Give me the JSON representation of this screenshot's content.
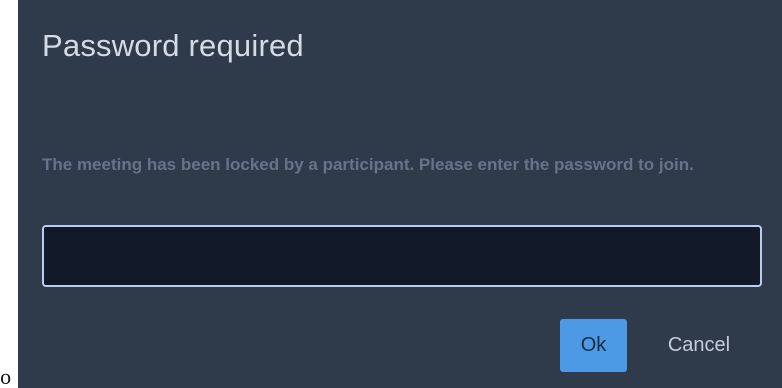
{
  "background_text": {
    "fragment": "to"
  },
  "dialog": {
    "title": "Password required",
    "message": "The meeting has been locked by a participant. Please enter the password to join.",
    "password_input": {
      "value": "",
      "placeholder": ""
    },
    "ok_label": "Ok",
    "cancel_label": "Cancel"
  },
  "colors": {
    "dialog_background": "#2f3a4b",
    "input_background": "#121a29",
    "input_border": "#b9cdf0",
    "primary_button": "#4c9ae6",
    "title_text": "#d4dbe5",
    "message_text": "#66738a"
  }
}
